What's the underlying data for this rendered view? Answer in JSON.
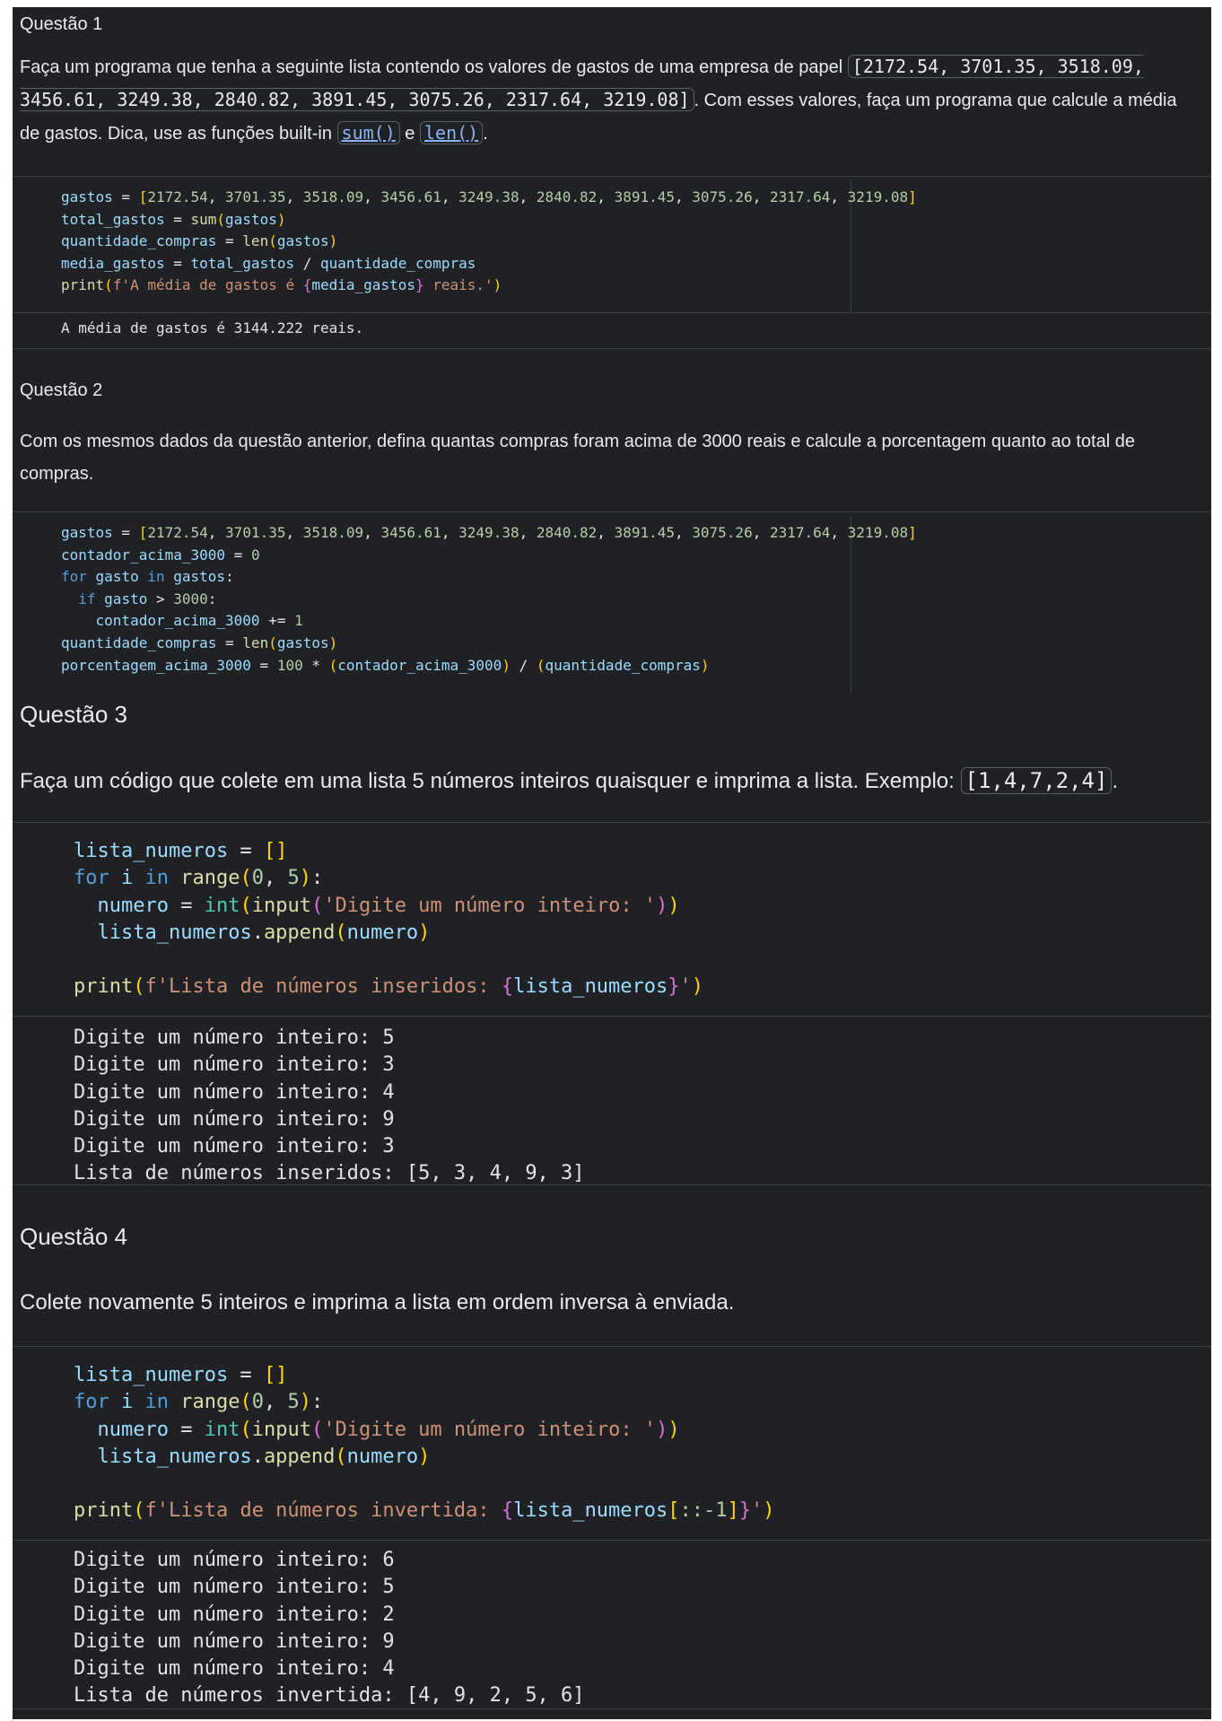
{
  "q1": {
    "heading": "Questão 1",
    "text_before": "Faça um programa que tenha a seguinte lista contendo os valores de gastos de uma empresa de papel ",
    "list_inline": "[2172.54, 3701.35, 3518.09, 3456.61, 3249.38, 2840.82, 3891.45, 3075.26, 2317.64, 3219.08]",
    "text_mid": ". Com esses valores, faça um programa que calcule a média de gastos. Dica, use as funções built-in ",
    "link_sum": "sum()",
    "text_and": " e ",
    "link_len": "len()",
    "text_end": ".",
    "code": [
      "gastos = [2172.54, 3701.35, 3518.09, 3456.61, 3249.38, 2840.82, 3891.45, 3075.26, 2317.64, 3219.08]",
      "total_gastos = sum(gastos)",
      "quantidade_compras = len(gastos)",
      "media_gastos = total_gastos / quantidade_compras",
      "print(f'A média de gastos é {media_gastos} reais.')"
    ],
    "output": "A média de gastos é 3144.222 reais."
  },
  "q2": {
    "heading": "Questão 2",
    "text": "Com os mesmos dados da questão anterior, defina quantas compras foram acima de 3000 reais e calcule a porcentagem quanto ao total de compras.",
    "code": [
      "gastos = [2172.54, 3701.35, 3518.09, 3456.61, 3249.38, 2840.82, 3891.45, 3075.26, 2317.64, 3219.08]",
      "contador_acima_3000 = 0",
      "for gasto in gastos:",
      "  if gasto > 3000:",
      "    contador_acima_3000 += 1",
      "quantidade_compras = len(gastos)",
      "porcentagem_acima_3000 = 100 * (contador_acima_3000) / (quantidade_compras)"
    ]
  },
  "q3": {
    "heading": "Questão 3",
    "text_before": "Faça um código que colete em uma lista 5 números inteiros quaisquer e imprima a lista. Exemplo: ",
    "example": "[1,4,7,2,4]",
    "text_end": ".",
    "code": [
      "lista_numeros = []",
      "for i in range(0, 5):",
      "  numero = int(input('Digite um número inteiro: '))",
      "  lista_numeros.append(numero)",
      "",
      "print(f'Lista de números inseridos: {lista_numeros}')"
    ],
    "output": [
      "Digite um número inteiro: 5",
      "Digite um número inteiro: 3",
      "Digite um número inteiro: 4",
      "Digite um número inteiro: 9",
      "Digite um número inteiro: 3",
      "Lista de números inseridos: [5, 3, 4, 9, 3]"
    ]
  },
  "q4": {
    "heading": "Questão 4",
    "text": "Colete novamente 5 inteiros e imprima a lista em ordem inversa à enviada.",
    "code": [
      "lista_numeros = []",
      "for i in range(0, 5):",
      "  numero = int(input('Digite um número inteiro: '))",
      "  lista_numeros.append(numero)",
      "",
      "print(f'Lista de números invertida: {lista_numeros[::-1]}')"
    ],
    "output": [
      "Digite um número inteiro: 6",
      "Digite um número inteiro: 5",
      "Digite um número inteiro: 2",
      "Digite um número inteiro: 9",
      "Digite um número inteiro: 4",
      "Lista de números invertida: [4, 9, 2, 5, 6]"
    ]
  }
}
